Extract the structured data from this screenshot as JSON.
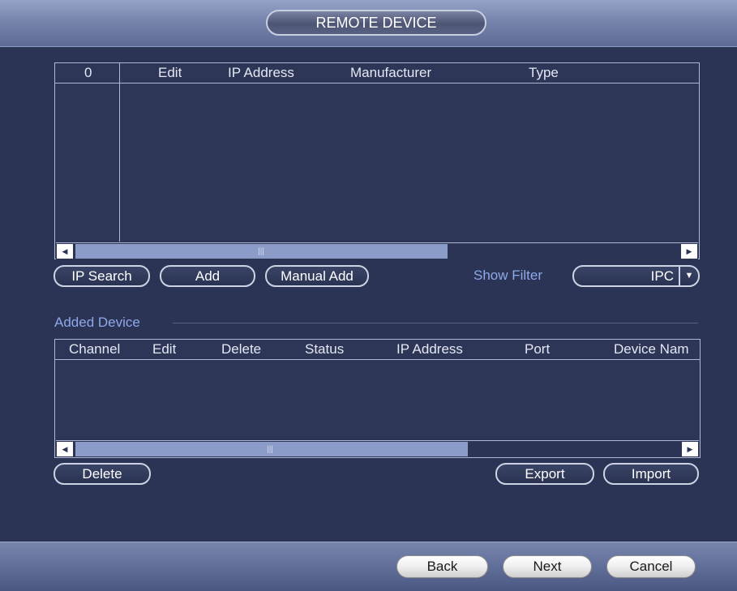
{
  "window": {
    "title": "REMOTE DEVICE"
  },
  "search_table": {
    "columns": [
      "0",
      "Edit",
      "IP Address",
      "Manufacturer",
      "Type"
    ],
    "rows": []
  },
  "search_buttons": {
    "ip_search": "IP Search",
    "add": "Add",
    "manual_add": "Manual Add"
  },
  "filter": {
    "label": "Show Filter",
    "value": "IPC"
  },
  "added_device": {
    "section_label": "Added Device",
    "columns": [
      "Channel",
      "Edit",
      "Delete",
      "Status",
      "IP Address",
      "Port",
      "Device Nam"
    ],
    "rows": []
  },
  "added_buttons": {
    "delete": "Delete",
    "export": "Export",
    "import": "Import"
  },
  "footer": {
    "back": "Back",
    "next": "Next",
    "cancel": "Cancel"
  },
  "colors": {
    "background": "#2b3454",
    "accent_label": "#8ea8e8",
    "border": "#aeb7d2"
  }
}
